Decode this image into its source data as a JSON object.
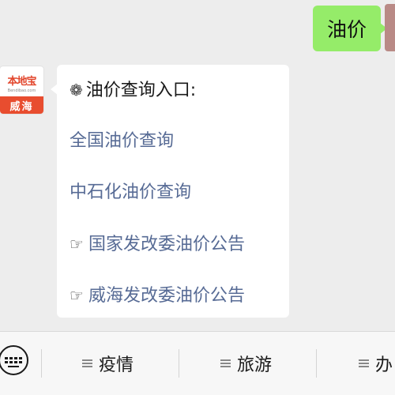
{
  "chat": {
    "outgoing_message": "油价",
    "sender": {
      "logo_title": "本地宝",
      "logo_url": "Bendibao.com",
      "logo_city": "威海"
    },
    "incoming_card": {
      "heading_icon": "flower-icon",
      "heading": "油价查询入口:",
      "links": [
        {
          "text": "全国油价查询",
          "icon": ""
        },
        {
          "text": "中石化油价查询",
          "icon": ""
        },
        {
          "text": "国家发改委油价公告",
          "icon": "pointing-hand-icon"
        },
        {
          "text": "威海发改委油价公告",
          "icon": "pointing-hand-icon"
        }
      ]
    }
  },
  "menubar": {
    "keyboard_icon": "keyboard-icon",
    "items": [
      {
        "label": "疫情",
        "icon": "menu-icon"
      },
      {
        "label": "旅游",
        "icon": "menu-icon"
      },
      {
        "label": "办",
        "icon": "menu-icon"
      }
    ]
  },
  "colors": {
    "background": "#ededed",
    "outgoing_bubble": "#95ec69",
    "link": "#576b95",
    "logo_red": "#e84d2f"
  }
}
